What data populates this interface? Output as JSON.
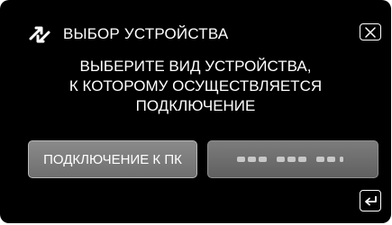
{
  "header": {
    "icon": "device-connection-arrows-icon",
    "title": "ВЫБОР УСТРОЙСТВА",
    "close_icon": "close-icon"
  },
  "instruction": {
    "lines": [
      "ВЫБЕРИТЕ ВИД УСТРОЙСТВА,",
      "К КОТОРОМУ ОСУЩЕСТВЛЯЕТСЯ",
      "ПОДКЛЮЧЕНИЕ"
    ]
  },
  "options": {
    "pc_label": "ПОДКЛЮЧЕНИЕ К ПК"
  },
  "footer": {
    "back_icon": "return-arrow-icon"
  },
  "colors": {
    "background": "#000000",
    "text": "#ffffff",
    "button": "#7a7a7a"
  }
}
